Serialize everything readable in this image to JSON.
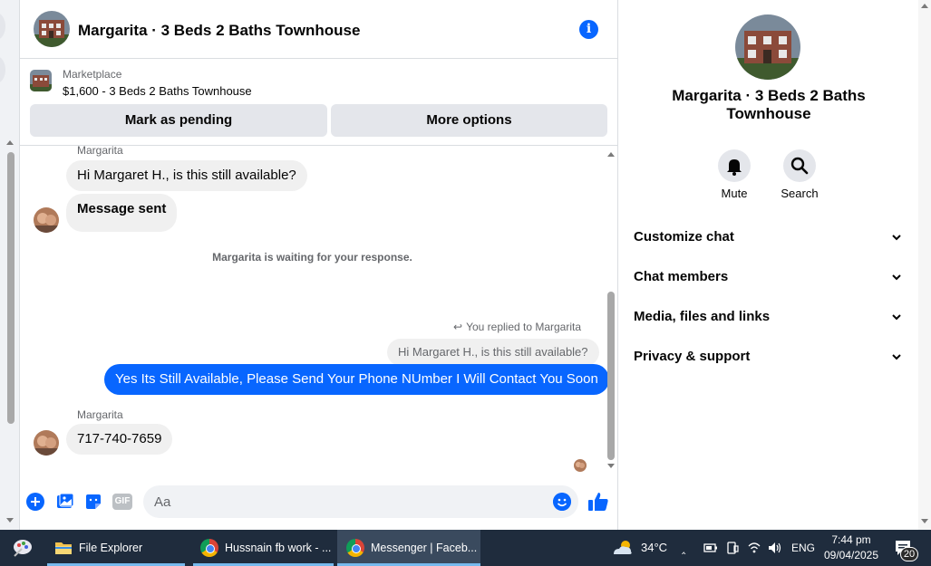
{
  "chat": {
    "title": "Margarita · 3 Beds 2 Baths Townhouse",
    "listing": {
      "label": "Marketplace",
      "price_title": "$1,600 - 3 Beds 2 Baths Townhouse",
      "mark_pending": "Mark as pending",
      "more_options": "More options"
    },
    "messages": {
      "sender_top": "Margarita",
      "msg1": "Hi Margaret H., is this still available?",
      "msg2": "Message sent",
      "waiting": "Margarita is waiting for your response.",
      "replied": "You replied to Margarita",
      "quoted": "Hi Margaret H., is this still available?",
      "outgoing": "Yes Its Still Available, Please Send Your Phone NUmber I Will Contact You Soon",
      "sender_bottom": "Margarita",
      "msg3": "717-740-7659"
    },
    "composer": {
      "placeholder": "Aa",
      "gif_label": "GIF"
    }
  },
  "panel": {
    "title": "Margarita · 3 Beds 2 Baths Townhouse",
    "mute_label": "Mute",
    "search_label": "Search",
    "menu": [
      "Customize chat",
      "Chat members",
      "Media, files and links",
      "Privacy & support"
    ]
  },
  "taskbar": {
    "items": [
      "File Explorer",
      "Hussnain fb work - ...",
      "Messenger | Faceb..."
    ],
    "weather": "34°C",
    "language": "ENG",
    "time": "7:44 pm",
    "date": "09/04/2025",
    "notifications": "20"
  },
  "colors": {
    "accent": "#0866ff",
    "bubble_in": "#f0f0f0",
    "button_bg": "#e4e6eb",
    "taskbar": "#1f2c3d"
  }
}
